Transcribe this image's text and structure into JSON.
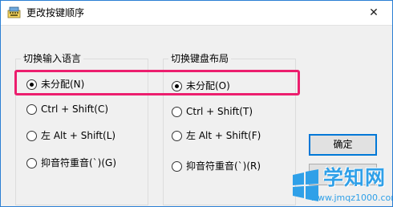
{
  "window": {
    "title": "更改按键顺序",
    "close_glyph": "✕"
  },
  "groups": {
    "input_language": {
      "title": "切换输入语言",
      "options": [
        {
          "label": "未分配(N)",
          "checked": true
        },
        {
          "label": "Ctrl + Shift(C)",
          "checked": false
        },
        {
          "label": "左 Alt + Shift(L)",
          "checked": false
        },
        {
          "label": "抑音符重音(`)(G)",
          "checked": false
        }
      ]
    },
    "keyboard_layout": {
      "title": "切换键盘布局",
      "options": [
        {
          "label": "未分配(O)",
          "checked": true
        },
        {
          "label": "Ctrl + Shift(T)",
          "checked": false
        },
        {
          "label": "左 Alt + Shift(F)",
          "checked": false
        },
        {
          "label": "抑音符重音(`)(R)",
          "checked": false
        }
      ]
    }
  },
  "buttons": {
    "ok_label": "确定"
  },
  "watermark": {
    "title": "学知网",
    "url": "www.jmqz1000.com"
  },
  "colors": {
    "highlight": "#ec1e6e",
    "default_button_border": "#0078d7",
    "window_border": "#2b7fd4",
    "watermark": "#2fa0e8"
  }
}
